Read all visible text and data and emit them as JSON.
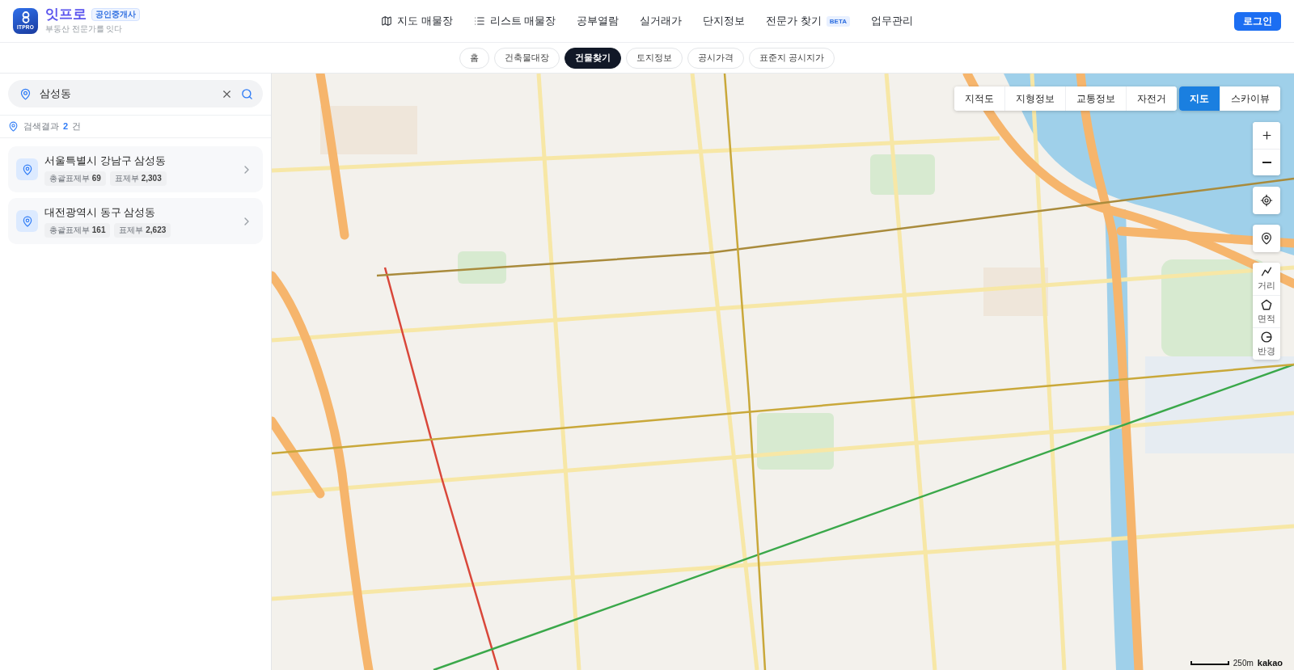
{
  "header": {
    "logo": {
      "mark_text": "ITPRO",
      "name": "잇프로",
      "badge": "공인중개사",
      "tagline": "부동산 전문가를 잇다"
    },
    "nav": [
      {
        "label": "지도 매물장",
        "kind": "map"
      },
      {
        "label": "리스트 매물장",
        "kind": "list"
      },
      {
        "label": "공부열람",
        "kind": "plain"
      },
      {
        "label": "실거래가",
        "kind": "plain"
      },
      {
        "label": "단지정보",
        "kind": "plain"
      },
      {
        "label": "전문가 찾기",
        "kind": "plain",
        "badge": "BETA"
      },
      {
        "label": "업무관리",
        "kind": "plain"
      }
    ],
    "login_button": "로그인"
  },
  "subtabs": [
    {
      "label": "홈",
      "selected": false
    },
    {
      "label": "건축물대장",
      "selected": false
    },
    {
      "label": "건물찾기",
      "selected": true
    },
    {
      "label": "토지정보",
      "selected": false
    },
    {
      "label": "공시가격",
      "selected": false
    },
    {
      "label": "표준지 공시지가",
      "selected": false
    }
  ],
  "search": {
    "value": "삼성동"
  },
  "result_summary": "검색결과 **2** 건",
  "results": [
    {
      "title": "서울특별시 강남구 삼성동",
      "tags": [
        "총괄표제부 **69**",
        "표제부 **2,303**"
      ]
    },
    {
      "title": "대전광역시 동구 삼성동",
      "tags": [
        "총괄표제부 **161**",
        "표제부 **2,623**"
      ]
    }
  ],
  "map": {
    "layers": [
      {
        "label": "지적도",
        "selected": false
      },
      {
        "label": "지형정보",
        "selected": false
      },
      {
        "label": "교통정보",
        "selected": false
      },
      {
        "label": "자전거",
        "selected": false
      }
    ],
    "map_types": [
      {
        "label": "지도",
        "selected": true
      },
      {
        "label": "스카이뷰",
        "selected": false
      }
    ],
    "tools": [
      {
        "label": "거리",
        "kind": "distance"
      },
      {
        "label": "면적",
        "kind": "area"
      },
      {
        "label": "반경",
        "kind": "radius"
      }
    ],
    "scale": "250m",
    "attribution": "kakao"
  }
}
